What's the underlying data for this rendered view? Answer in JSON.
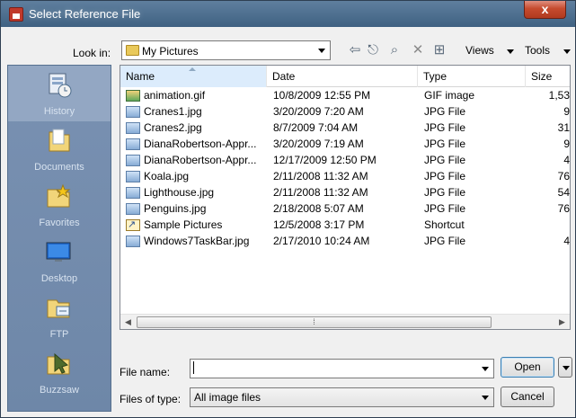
{
  "window": {
    "title": "Select Reference File",
    "close_glyph": "x"
  },
  "toolbar": {
    "look_in_label": "Look in:",
    "look_in_value": "My Pictures",
    "views_label": "Views",
    "tools_label": "Tools",
    "icons": [
      "back-icon",
      "up-folder-icon",
      "search-web-icon",
      "delete-icon",
      "new-folder-icon"
    ]
  },
  "places": {
    "items": [
      {
        "label": "History",
        "icon": "history-icon"
      },
      {
        "label": "Documents",
        "icon": "documents-icon"
      },
      {
        "label": "Favorites",
        "icon": "favorites-icon"
      },
      {
        "label": "Desktop",
        "icon": "desktop-icon"
      },
      {
        "label": "FTP",
        "icon": "ftp-icon"
      },
      {
        "label": "Buzzsaw",
        "icon": "buzzsaw-icon"
      }
    ]
  },
  "filelist": {
    "columns": [
      "Name",
      "Date",
      "Type",
      "Size"
    ],
    "rows": [
      {
        "name": "animation.gif",
        "date": "10/8/2009 12:55 PM",
        "type": "GIF image",
        "size": "1,53",
        "icon": "gif-file-icon"
      },
      {
        "name": "Cranes1.jpg",
        "date": "3/20/2009 7:20 AM",
        "type": "JPG File",
        "size": "9",
        "icon": "jpg-file-icon"
      },
      {
        "name": "Cranes2.jpg",
        "date": "8/7/2009 7:04 AM",
        "type": "JPG File",
        "size": "31",
        "icon": "jpg-file-icon"
      },
      {
        "name": "DianaRobertson-Appr...",
        "date": "3/20/2009 7:19 AM",
        "type": "JPG File",
        "size": "9",
        "icon": "jpg-file-icon"
      },
      {
        "name": "DianaRobertson-Appr...",
        "date": "12/17/2009 12:50 PM",
        "type": "JPG File",
        "size": "4",
        "icon": "jpg-file-icon"
      },
      {
        "name": "Koala.jpg",
        "date": "2/11/2008 11:32 AM",
        "type": "JPG File",
        "size": "76",
        "icon": "jpg-file-icon"
      },
      {
        "name": "Lighthouse.jpg",
        "date": "2/11/2008 11:32 AM",
        "type": "JPG File",
        "size": "54",
        "icon": "jpg-file-icon"
      },
      {
        "name": "Penguins.jpg",
        "date": "2/18/2008 5:07 AM",
        "type": "JPG File",
        "size": "76",
        "icon": "jpg-file-icon"
      },
      {
        "name": "Sample Pictures",
        "date": "12/5/2008 3:17 PM",
        "type": "Shortcut",
        "size": "",
        "icon": "shortcut-icon"
      },
      {
        "name": "Windows7TaskBar.jpg",
        "date": "2/17/2010 10:24 AM",
        "type": "JPG File",
        "size": "4",
        "icon": "jpg-file-icon"
      }
    ]
  },
  "form": {
    "file_name_label": "File name:",
    "file_name_value": "",
    "files_of_type_label": "Files of type:",
    "files_of_type_value": "All image files",
    "open_label": "Open",
    "cancel_label": "Cancel"
  }
}
